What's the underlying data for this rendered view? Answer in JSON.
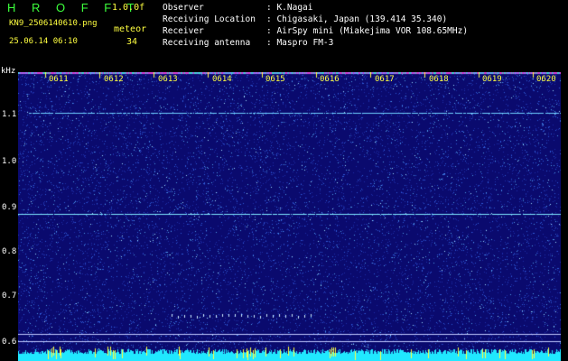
{
  "header": {
    "logo": "H R O F F T",
    "version": "1.0.0f",
    "filename": "KN9_2506140610.png",
    "mode": "meteor",
    "datetime": "25.06.14 06:10",
    "count": "34"
  },
  "metadata": [
    {
      "key": "Observer",
      "value": ": K.Nagai"
    },
    {
      "key": "Receiving Location",
      "value": ": Chigasaki, Japan (139.414 35.340)"
    },
    {
      "key": "Receiver",
      "value": ": AirSpy mini (Miakejima VOR 108.65MHz)"
    },
    {
      "key": "Receiving antenna",
      "value": ": Maspro FM-3"
    }
  ],
  "y_axis": {
    "unit": "kHz",
    "labels": [
      "1.1",
      "1.0",
      "0.9",
      "0.8",
      "0.7",
      "0.6"
    ]
  },
  "time_labels": [
    "0611",
    "0612",
    "0613",
    "0614",
    "0615",
    "0616",
    "0617",
    "0618",
    "0619",
    "0620"
  ],
  "colors": {
    "background": "#0a0a6e",
    "logo": "#3cff3c",
    "header_text": "#ffff40",
    "carrier": "#7fe6ff",
    "floor": "#20e8ff"
  }
}
